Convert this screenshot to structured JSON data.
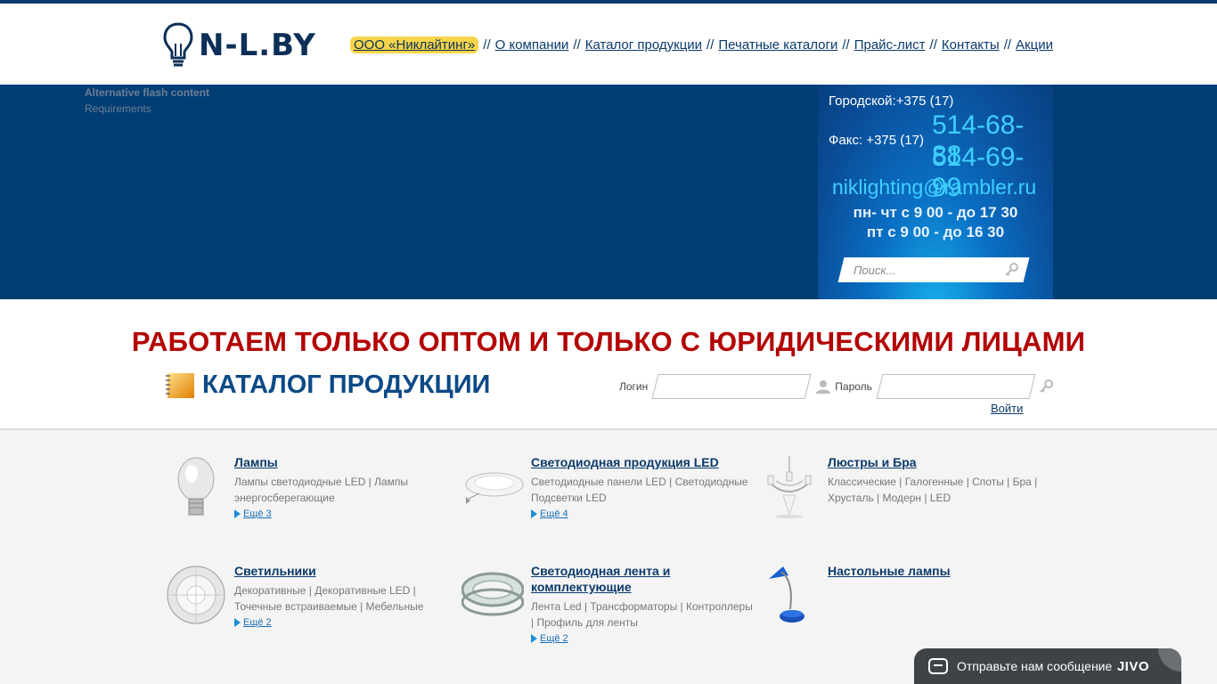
{
  "header": {
    "logo_text": "N-L.BY",
    "nav": [
      {
        "label": "ООО «Никлайтинг»",
        "highlight": true
      },
      {
        "label": "О компании"
      },
      {
        "label": "Каталог продукции"
      },
      {
        "label": "Печатные каталоги"
      },
      {
        "label": "Прайс-лист"
      },
      {
        "label": "Контакты"
      },
      {
        "label": "Акции"
      }
    ],
    "nav_separator": "//"
  },
  "banner": {
    "flash_alt": "Alternative flash content",
    "flash_req": "Requirements"
  },
  "contacts": {
    "city_label": "Городской:+375 (17)",
    "fax_label": "Факс: +375 (17)",
    "phone_1": "514-68-88",
    "phone_2": "514-69-99",
    "email": "niklighting@rambler.ru",
    "hours_1": "пн- чт  с 9 00 - до 17 30",
    "hours_2": "пт с 9 00 - до 16 30",
    "search_placeholder": "Поиск..."
  },
  "notice": "РАБОТАЕМ ТОЛЬКО ОПТОМ И ТОЛЬКО С ЮРИДИЧЕСКИМИ ЛИЦАМИ",
  "catalog": {
    "title": "КАТАЛОГ ПРОДУКЦИИ",
    "items": [
      {
        "name": "Лампы",
        "desc": "Лампы светодиодные LED | Лампы энергосберегающие",
        "more": "Ещё 3",
        "icon": "lamp-bulb-icon"
      },
      {
        "name": "Светодиодная продукция LED",
        "desc": "Светодиодные панели LED | Светодиодные Подсветки LED",
        "more": "Ещё 4",
        "icon": "led-panel-icon"
      },
      {
        "name": "Люстры и Бра",
        "desc": "Классические | Галогенные | Споты | Бра | Хрусталь | Модерн | LED",
        "more": "",
        "icon": "chandelier-icon"
      },
      {
        "name": "Светильники",
        "desc": "Декоративные | Декоративные LED | Точечные встраиваемые | Мебельные",
        "more": "Ещё 2",
        "icon": "crystal-fixture-icon"
      },
      {
        "name": "Светодиодная лента и комплектующие",
        "desc": "Лента Led | Трансформаторы | Контроллеры | Профиль для ленты",
        "more": "Ещё 2",
        "icon": "led-strip-icon"
      },
      {
        "name": "Настольные лампы",
        "desc": "",
        "more": "",
        "icon": "desk-lamp-icon"
      }
    ]
  },
  "login": {
    "login_label": "Логин",
    "password_label": "Пароль",
    "submit_label": "Войти"
  },
  "chat": {
    "label": "Отправьте нам сообщение",
    "brand": "JIVO"
  }
}
